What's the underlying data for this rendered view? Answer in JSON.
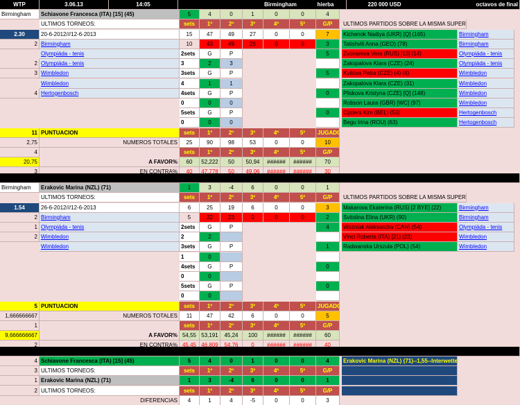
{
  "header": {
    "tour": "WTP",
    "date": "3.06.13",
    "time": "14:05",
    "city": "Birmingham",
    "surface": "hierba",
    "prize": "220 000 USD",
    "round": "octavos de final"
  },
  "cols": {
    "sets": "sets",
    "s1": "1º",
    "s2": "2º",
    "s3": "3º",
    "s4": "4º",
    "s5": "5º",
    "gp": "G/P",
    "jugados": "JUGADOS"
  },
  "labels": {
    "ultimos": "ULTIMOS TORNEOS:",
    "ultimos_sup": "ULTIMOS PARTIDOS SOBRE LA MISMA SUPERFICIE",
    "puntuacion": "PUNTUACION",
    "numeros": "NUMEROS TOTALES",
    "afavor": "A FAVOR%",
    "encontra": "EN CONTRA%",
    "diferencias": "DIFERENCIAS",
    "twosets": "2sets",
    "threesets": "3sets",
    "foursets": "4sets",
    "fivesets": "5sets",
    "g": "G",
    "p": "P"
  },
  "p1": {
    "city": "Birmingham",
    "name": "Schiavone Francesca (ITA) [15] (45)",
    "odds": "2.30",
    "dates": "20-6-2012///12-6-2013",
    "top": [
      "5",
      "4",
      "0",
      "1",
      "0",
      "0",
      "4"
    ],
    "r1": [
      "15",
      "47",
      "49",
      "27",
      "0",
      "0",
      "7"
    ],
    "r2": [
      "10",
      "43",
      "49",
      "26",
      "0",
      "0",
      "3"
    ],
    "tourn": [
      "Birmingham",
      "Olympiáda - tenis",
      "Olympiáda - tenis",
      "Wimbledon",
      "Wimbledon",
      "Hertogenbosch"
    ],
    "nums": [
      "2",
      "2",
      "3",
      "4"
    ],
    "s2": [
      "5",
      "3",
      "2",
      "3"
    ],
    "s3": [
      "5",
      "4",
      "1",
      "1"
    ],
    "s4": [
      "0",
      "0",
      "0",
      "0"
    ],
    "s5": [
      "0",
      "0",
      "0",
      "0"
    ],
    "pts": "11",
    "totals_a": "2,75",
    "totals_b": "4",
    "favor_a": "20,75",
    "contra_a": "3",
    "tot": [
      "25",
      "90",
      "98",
      "53",
      "0",
      "0",
      "10"
    ],
    "fav": [
      "60",
      "52,222",
      "50",
      "50,94",
      "######",
      "######",
      "70"
    ],
    "con": [
      "40",
      "47,778",
      "50",
      "49,06",
      "######",
      "######",
      "30"
    ],
    "recent": [
      {
        "opp": "Kichenok Nadiya (UKR) [Q] (165)",
        "t": "Birmingham",
        "c": "gr"
      },
      {
        "opp": "Tatishvili Anna (GEO) (78)",
        "t": "Birmingham",
        "c": "gr"
      },
      {
        "opp": "Zvonareva Vera (RUS) [13] (14)",
        "t": "Olympiáda - tenis",
        "c": "rd"
      },
      {
        "opp": "Zakopalova Klara (CZE) (24)",
        "t": "Olympiáda - tenis",
        "c": "gr"
      },
      {
        "opp": "Kvitova Petra (CZE) (4) (4)",
        "t": "Wimbledon",
        "c": "rd"
      },
      {
        "opp": "Zakopalova Klara (CZE) (31)",
        "t": "Wimbledon",
        "c": "gr"
      },
      {
        "opp": "Pliskova Kristyna (CZE) [Q] (148)",
        "t": "Wimbledon",
        "c": "gr"
      },
      {
        "opp": "Robson Laura (GBR) [WC] (97)",
        "t": "Wimbledon",
        "c": "gr"
      },
      {
        "opp": "Cijsters Kim (BEL) (53)",
        "t": "Hertogenbosch",
        "c": "rd"
      },
      {
        "opp": "Begu Irina (ROU) (63)",
        "t": "Hertogenbosch",
        "c": "gr"
      }
    ]
  },
  "p2": {
    "city": "Birmingham",
    "name": "Erakovic Marina (NZL) (71)",
    "odds": "1.54",
    "dates": "26-6-2012///12-6-2013",
    "top": [
      "1",
      "3",
      "-4",
      "6",
      "0",
      "0",
      "1"
    ],
    "r1": [
      "6",
      "25",
      "19",
      "6",
      "0",
      "0",
      "3"
    ],
    "r2": [
      "5",
      "22",
      "23",
      "0",
      "0",
      "0",
      "2"
    ],
    "tourn": [
      "Birmingham",
      "Olympiáda - tenis",
      "Wimbledon",
      "Wimbledon"
    ],
    "nums": [
      "2",
      "1",
      "2"
    ],
    "s2": [
      "4",
      "2",
      "2"
    ],
    "s3": [
      "1",
      "1",
      "0"
    ],
    "s4": [
      "0",
      "0",
      "0"
    ],
    "s5": [
      "0",
      "0",
      "0"
    ],
    "pts": "5",
    "totals_a": "1,666666667",
    "totals_b": "1",
    "favor_a": "9,666666667",
    "contra_a": "2",
    "tot": [
      "11",
      "47",
      "42",
      "6",
      "0",
      "0",
      "5"
    ],
    "fav": [
      "54,55",
      "53,191",
      "45,24",
      "100",
      "######",
      "######",
      "60"
    ],
    "con": [
      "45,45",
      "46,809",
      "54,76",
      "0",
      "######",
      "######",
      "40"
    ],
    "recent": [
      {
        "opp": "Makarova Ekaterina (RUS) [2 BYE] (22)",
        "t": "Birmingham",
        "c": "gr"
      },
      {
        "opp": "Svitolina Elina (UKR) (90)",
        "t": "Birmingham",
        "c": "gr"
      },
      {
        "opp": "Wozniak Aleksandra (CAN) (54)",
        "t": "Olympiáda - tenis",
        "c": "rd"
      },
      {
        "opp": "Vinci Roberta (ITA) [21] (23)",
        "t": "Wimbledon",
        "c": "rd"
      },
      {
        "opp": "Radwanska Urszula (POL) (54)",
        "t": "Wimbledon",
        "c": "gr"
      }
    ]
  },
  "summary": {
    "row1": {
      "n": "4",
      "name": "Schiavone Francesca (ITA) [15] (45)",
      "v": [
        "5",
        "4",
        "0",
        "1",
        "0",
        "0",
        "4"
      ]
    },
    "row2": {
      "n": "3",
      "label": "ULTIMOS TORNEOS:",
      "v": [
        "sets",
        "1º",
        "2º",
        "3º",
        "4º",
        "5º",
        "G/P"
      ]
    },
    "row3": {
      "n": "1",
      "name": "Erakovic Marina (NZL) (71)",
      "v": [
        "1",
        "3",
        "-4",
        "6",
        "0",
        "0",
        "1"
      ]
    },
    "row4": {
      "n": "2",
      "label": "ULTIMOS TORNEOS:",
      "v": [
        "sets",
        "1º",
        "2º",
        "3º",
        "4º",
        "5º",
        "G/P"
      ]
    },
    "row5": {
      "label": "DIFERENCIAS",
      "v": [
        "4",
        "1",
        "4",
        "-5",
        "0",
        "0",
        "3"
      ]
    },
    "note": "Erakovic Marina (NZL) (71)--1,55--Interwetten"
  }
}
